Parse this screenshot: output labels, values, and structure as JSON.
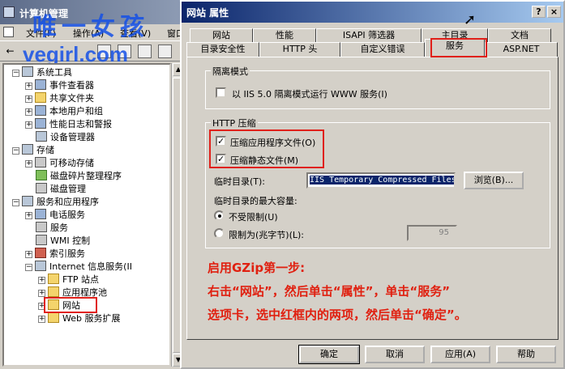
{
  "mmc": {
    "title": "计算机管理",
    "menu": [
      "文件(F)",
      "操作(A)",
      "查看(V)",
      "窗口"
    ],
    "watermark": {
      "cn": "唯一女孩",
      "url": "vegirl.com"
    },
    "tree": [
      {
        "label": "系统工具",
        "exp": "−",
        "icon": "pc"
      },
      {
        "label": "事件查看器",
        "exp": "+",
        "icon": ""
      },
      {
        "label": "共享文件夹",
        "exp": "+",
        "icon": "folder"
      },
      {
        "label": "本地用户和组",
        "exp": "+",
        "icon": ""
      },
      {
        "label": "性能日志和警报",
        "exp": "+",
        "icon": ""
      },
      {
        "label": "设备管理器",
        "exp": "",
        "icon": "pc"
      },
      {
        "label": "存储",
        "exp": "−",
        "icon": "pc"
      },
      {
        "label": "可移动存储",
        "exp": "+",
        "icon": "gray"
      },
      {
        "label": "磁盘碎片整理程序",
        "exp": "",
        "icon": "green"
      },
      {
        "label": "磁盘管理",
        "exp": "",
        "icon": "gray"
      },
      {
        "label": "服务和应用程序",
        "exp": "−",
        "icon": "pc"
      },
      {
        "label": "电话服务",
        "exp": "+",
        "icon": ""
      },
      {
        "label": "服务",
        "exp": "",
        "icon": "gray"
      },
      {
        "label": "WMI 控制",
        "exp": "",
        "icon": "gray"
      },
      {
        "label": "索引服务",
        "exp": "+",
        "icon": "red"
      },
      {
        "label": "Internet 信息服务(II",
        "exp": "−",
        "icon": "pc"
      },
      {
        "label": "FTP 站点",
        "exp": "+",
        "icon": "folder"
      },
      {
        "label": "应用程序池",
        "exp": "+",
        "icon": "folder"
      },
      {
        "label": "网站",
        "exp": "+",
        "icon": "folder"
      },
      {
        "label": "Web 服务扩展",
        "exp": "",
        "icon": "folder"
      }
    ]
  },
  "dialog": {
    "title": "网站 属性",
    "caption_help": "?",
    "caption_close": "×",
    "tabs_row1": [
      "网站",
      "性能",
      "ISAPI 筛选器",
      "主目录",
      "文档"
    ],
    "tabs_row2": [
      "目录安全性",
      "HTTP 头",
      "自定义错误",
      "服务",
      "ASP.NET"
    ],
    "active_tab": "服务",
    "isolation": {
      "legend": "隔离模式",
      "checkbox_label": "以 IIS 5.0 隔离模式运行 WWW 服务(I)",
      "checked": false
    },
    "compression": {
      "legend": "HTTP 压缩",
      "compress_app_label": "压缩应用程序文件(O)",
      "compress_app_checked": true,
      "compress_static_label": "压缩静态文件(M)",
      "compress_static_checked": true,
      "temp_dir_label": "临时目录(T):",
      "temp_dir_value": "IIS Temporary Compressed Files",
      "browse_label": "浏览(B)...",
      "max_size_label": "临时目录的最大容量:",
      "unlimited_label": "不受限制(U)",
      "limit_label": "限制为(兆字节)(L):",
      "limit_value": "95",
      "selected_option": "unlimited"
    },
    "buttons": {
      "ok": "确定",
      "cancel": "取消",
      "apply": "应用(A)",
      "help": "帮助"
    }
  },
  "instruction": {
    "line1": "启用GZip第一步:",
    "line2": "右击“网站”，然后单击“属性”，单击“服务”",
    "line3": "选项卡，选中红框内的两项，然后单击“确定”。"
  },
  "colors": {
    "highlight_box": "#e0201a",
    "instruction_text": "#e02010",
    "watermark": "#1450e6"
  }
}
